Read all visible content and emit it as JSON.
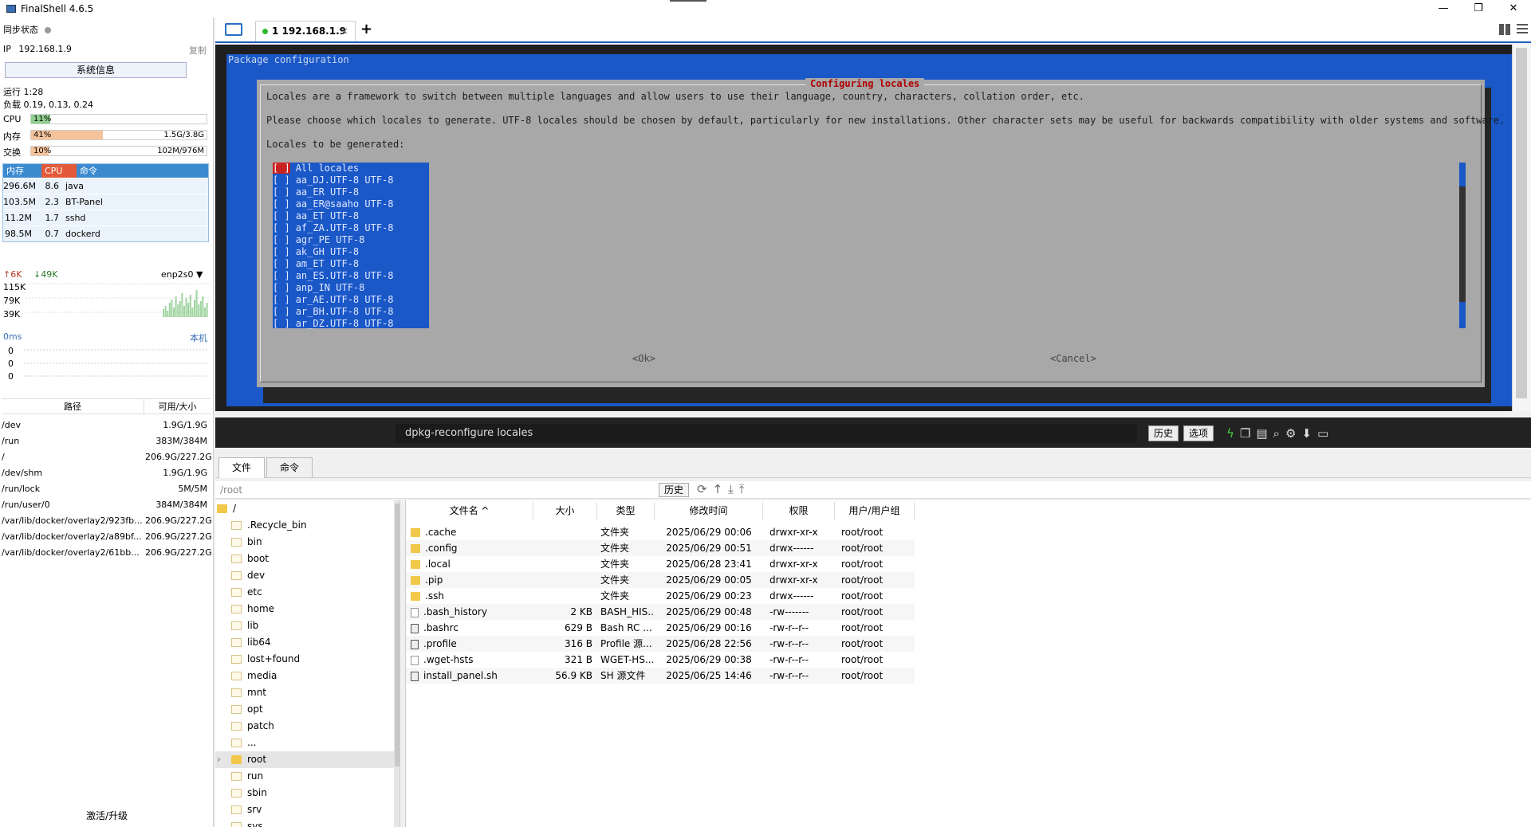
{
  "window": {
    "title": "FinalShell 4.6.5",
    "minimize": "—",
    "restore": "❐",
    "close": "✕"
  },
  "left": {
    "sync_label": "同步状态",
    "ip_label": "IP",
    "ip": "192.168.1.9",
    "copy": "复制",
    "sysinfo_btn": "系统信息",
    "uptime": "运行 1:28",
    "load": "负载 0.19, 0.13, 0.24",
    "cpu": {
      "label": "CPU",
      "pct": "11%",
      "level": 0.11
    },
    "mem": {
      "label": "内存",
      "pct": "41%",
      "amount": "1.5G/3.8G",
      "level": 0.41
    },
    "swap": {
      "label": "交换",
      "pct": "10%",
      "amount": "102M/976M",
      "level": 0.1
    },
    "proc_head": [
      "内存",
      "CPU",
      "命令"
    ],
    "procs": [
      {
        "mem": "296.6M",
        "cpu": "8.6",
        "cmd": "java"
      },
      {
        "mem": "103.5M",
        "cpu": "2.3",
        "cmd": "BT-Panel"
      },
      {
        "mem": "11.2M",
        "cpu": "1.7",
        "cmd": "sshd"
      },
      {
        "mem": "98.5M",
        "cpu": "0.7",
        "cmd": "dockerd"
      }
    ],
    "net": {
      "up": "6K",
      "down": "49K",
      "iface": "enp2s0",
      "y1": "115K",
      "y2": "79K",
      "y3": "39K"
    },
    "ping": {
      "ms": "0ms",
      "host": "本机",
      "v1": "0",
      "v2": "0",
      "v3": "0"
    },
    "disk_head": [
      "路径",
      "可用/大小"
    ],
    "disks": [
      {
        "path": "/dev",
        "size": "1.9G/1.9G"
      },
      {
        "path": "/run",
        "size": "383M/384M"
      },
      {
        "path": "/",
        "size": "206.9G/227.2G"
      },
      {
        "path": "/dev/shm",
        "size": "1.9G/1.9G"
      },
      {
        "path": "/run/lock",
        "size": "5M/5M"
      },
      {
        "path": "/run/user/0",
        "size": "384M/384M"
      },
      {
        "path": "/var/lib/docker/overlay2/923fb...",
        "size": "206.9G/227.2G"
      },
      {
        "path": "/var/lib/docker/overlay2/a89bf...",
        "size": "206.9G/227.2G"
      },
      {
        "path": "/var/lib/docker/overlay2/61bb...",
        "size": "206.9G/227.2G"
      }
    ],
    "activate": "激活/升级"
  },
  "tabs": {
    "session": "1 192.168.1.9",
    "close": "×",
    "add": "+"
  },
  "terminal": {
    "header": "Package configuration",
    "dialog_title": "Configuring locales",
    "line1": "Locales are a framework to switch between multiple languages and allow users to use their language, country, characters, collation order, etc.",
    "line2": "Please choose which locales to generate. UTF-8 locales should be chosen by default, particularly for new installations. Other character sets may be useful for backwards compatibility with older systems and software.",
    "line3": "Locales to be generated:",
    "locales": [
      "All locales",
      "aa_DJ.UTF-8 UTF-8",
      "aa_ER UTF-8",
      "aa_ER@saaho UTF-8",
      "aa_ET UTF-8",
      "af_ZA.UTF-8 UTF-8",
      "agr_PE UTF-8",
      "ak_GH UTF-8",
      "am_ET UTF-8",
      "an_ES.UTF-8 UTF-8",
      "anp_IN UTF-8",
      "ar_AE.UTF-8 UTF-8",
      "ar_BH.UTF-8 UTF-8",
      "ar_DZ.UTF-8 UTF-8"
    ],
    "checkbox": "[ ]",
    "ok": "<Ok>",
    "cancel": "<Cancel>"
  },
  "cmdbar": {
    "command": "dpkg-reconfigure locales",
    "history": "历史",
    "options": "选项"
  },
  "files": {
    "tab_files": "文件",
    "tab_commands": "命令",
    "path": "/root",
    "history": "历史",
    "tree": [
      "/",
      ".Recycle_bin",
      "bin",
      "boot",
      "dev",
      "etc",
      "home",
      "lib",
      "lib64",
      "lost+found",
      "media",
      "mnt",
      "opt",
      "patch",
      "...",
      "root",
      "run",
      "sbin",
      "srv",
      "sys"
    ],
    "columns": [
      "文件名 ^",
      "大小",
      "类型",
      "修改时间",
      "权限",
      "用户/用户组"
    ],
    "rows": [
      {
        "name": ".cache",
        "size": "",
        "type": "文件夹",
        "mtime": "2025/06/29 00:06",
        "perm": "drwxr-xr-x",
        "owner": "root/root",
        "kind": "folder"
      },
      {
        "name": ".config",
        "size": "",
        "type": "文件夹",
        "mtime": "2025/06/29 00:51",
        "perm": "drwx------",
        "owner": "root/root",
        "kind": "folder"
      },
      {
        "name": ".local",
        "size": "",
        "type": "文件夹",
        "mtime": "2025/06/28 23:41",
        "perm": "drwxr-xr-x",
        "owner": "root/root",
        "kind": "folder"
      },
      {
        "name": ".pip",
        "size": "",
        "type": "文件夹",
        "mtime": "2025/06/29 00:05",
        "perm": "drwxr-xr-x",
        "owner": "root/root",
        "kind": "folder"
      },
      {
        "name": ".ssh",
        "size": "",
        "type": "文件夹",
        "mtime": "2025/06/29 00:23",
        "perm": "drwx------",
        "owner": "root/root",
        "kind": "folder"
      },
      {
        "name": ".bash_history",
        "size": "2 KB",
        "type": "BASH_HIS...",
        "mtime": "2025/06/29 00:48",
        "perm": "-rw-------",
        "owner": "root/root",
        "kind": "file"
      },
      {
        "name": ".bashrc",
        "size": "629 B",
        "type": "Bash RC ...",
        "mtime": "2025/06/29 00:16",
        "perm": "-rw-r--r--",
        "owner": "root/root",
        "kind": "script"
      },
      {
        "name": ".profile",
        "size": "316 B",
        "type": "Profile 源...",
        "mtime": "2025/06/28 22:56",
        "perm": "-rw-r--r--",
        "owner": "root/root",
        "kind": "script"
      },
      {
        "name": ".wget-hsts",
        "size": "321 B",
        "type": "WGET-HS...",
        "mtime": "2025/06/29 00:38",
        "perm": "-rw-r--r--",
        "owner": "root/root",
        "kind": "file"
      },
      {
        "name": "install_panel.sh",
        "size": "56.9 KB",
        "type": "SH 源文件",
        "mtime": "2025/06/25 14:46",
        "perm": "-rw-r--r--",
        "owner": "root/root",
        "kind": "script"
      }
    ]
  }
}
